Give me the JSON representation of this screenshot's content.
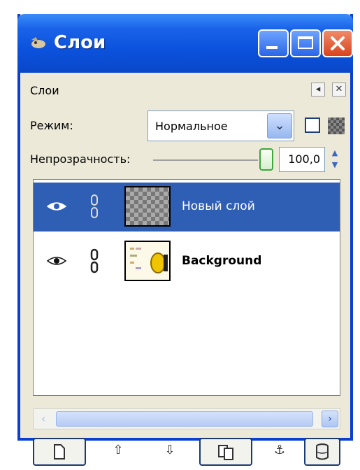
{
  "window": {
    "title": "Слои"
  },
  "panel": {
    "tab_label": "Слои",
    "mode_label": "Режим:",
    "mode_value": "Нормальное",
    "opacity_label": "Непрозрачность:",
    "opacity_value": "100,0",
    "opacity_level_percent": 100
  },
  "layers": [
    {
      "name": "Новый слой",
      "selected": true,
      "visible": true
    },
    {
      "name": "Background",
      "selected": false,
      "visible": true
    }
  ],
  "toolbar": {
    "buttons": [
      "new-layer-icon",
      "raise-layer-icon",
      "lower-layer-icon",
      "duplicate-layer-icon",
      "anchor-layer-icon",
      "delete-layer-icon"
    ]
  },
  "colors": {
    "titlebar": "#0b52dc",
    "selection": "#2f5eb5",
    "window_bg": "#ece9d8"
  }
}
